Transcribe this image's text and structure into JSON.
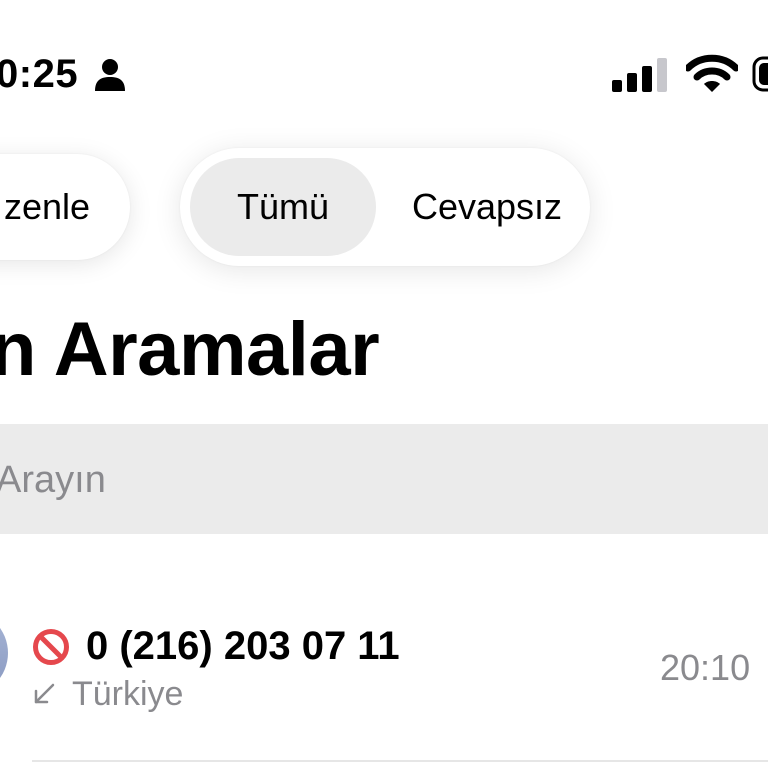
{
  "status_bar": {
    "time": "0:25",
    "icons": [
      "person-icon",
      "signal-icon",
      "wifi-icon",
      "battery-icon"
    ]
  },
  "nav": {
    "edit_label": "zenle",
    "segments": [
      {
        "label": "Tümü",
        "selected": true
      },
      {
        "label": "Cevapsız",
        "selected": false
      }
    ]
  },
  "title": "n Aramalar",
  "search": {
    "placeholder": "Arayın"
  },
  "calls": [
    {
      "number": "0 (216) 203 07 11",
      "location": "Türkiye",
      "time": "20:10",
      "blocked": true,
      "direction": "incoming",
      "icons": [
        "blocked-icon",
        "incoming-call-icon"
      ]
    }
  ],
  "colors": {
    "secondary_text": "#8a8a8e",
    "blocked_red": "#e5484d",
    "selected_segment": "#ebebeb",
    "search_background": "#ebebeb",
    "avatar": "#98a8cc"
  }
}
